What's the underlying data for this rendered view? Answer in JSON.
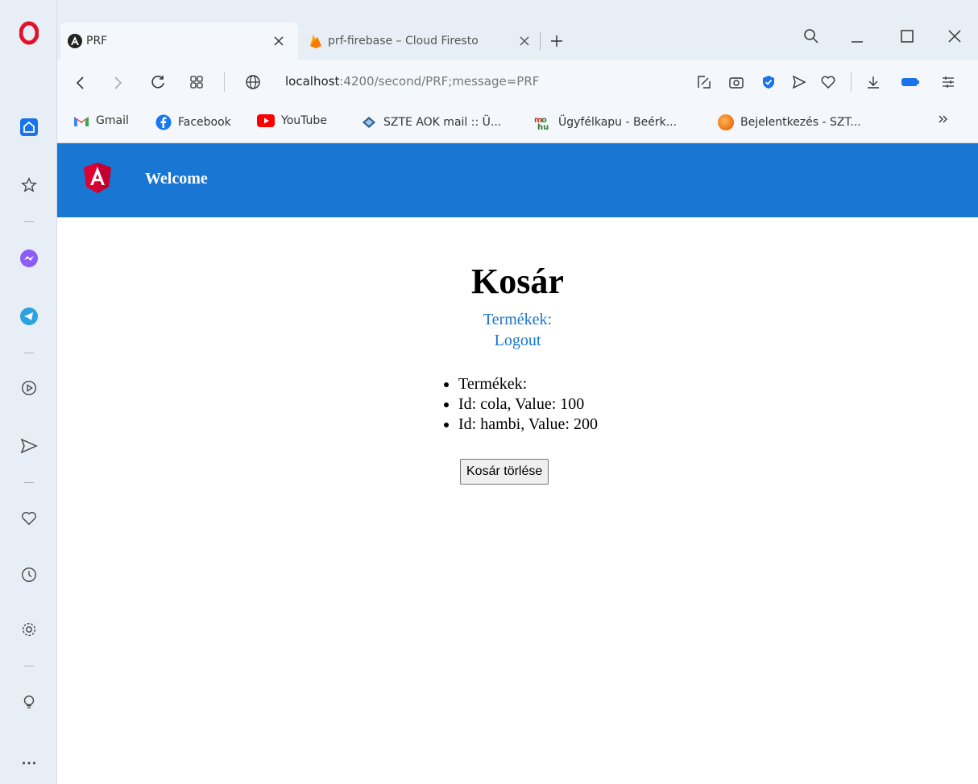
{
  "tabs": [
    {
      "title": "PRF",
      "active": true
    },
    {
      "title": "prf-firebase – Cloud Firesto",
      "active": false
    }
  ],
  "address": {
    "host": "localhost",
    "path": ":4200/second/PRF;message=PRF"
  },
  "bookmarks": [
    {
      "label": "Gmail",
      "icon": "gmail-icon"
    },
    {
      "label": "Facebook",
      "icon": "facebook-icon"
    },
    {
      "label": "YouTube",
      "icon": "youtube-icon"
    },
    {
      "label": "SZTE AOK mail :: Ü...",
      "icon": "mail-icon"
    },
    {
      "label": "Ügyfélkapu - Beérk...",
      "icon": "ugyfelkapu-icon"
    },
    {
      "label": "Bejelentkezés - SZT...",
      "icon": "orange-circle-icon"
    }
  ],
  "app": {
    "toolbar_title": "Welcome",
    "heading": "Kosár",
    "links": [
      "Termékek:",
      "Logout"
    ],
    "items": [
      "Termékek:",
      "Id: cola, Value: 100",
      "Id: hambi, Value: 200"
    ],
    "clear_button": "Kosár törlése"
  },
  "colors": {
    "toolbar": "#1976d2",
    "link": "#1976d2",
    "opera": "#e3122a",
    "angular": "#dd0031"
  }
}
